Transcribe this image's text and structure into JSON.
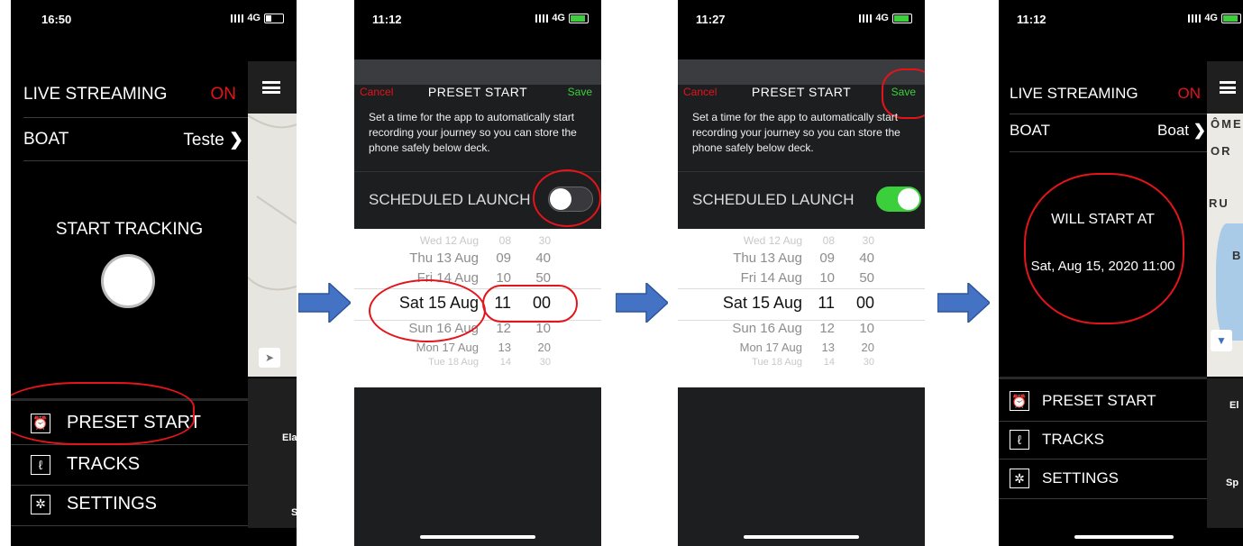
{
  "screen1": {
    "time": "16:50",
    "network": "4G",
    "live_streaming_label": "LIVE STREAMING",
    "live_streaming_value": "ON",
    "boat_label": "BOAT",
    "boat_value": "Teste",
    "start_tracking_label": "START TRACKING",
    "menu": [
      {
        "label": "PRESET START",
        "icon": "alarm-clock-icon"
      },
      {
        "label": "TRACKS",
        "icon": "track-path-icon"
      },
      {
        "label": "SETTINGS",
        "icon": "gear-icon"
      }
    ],
    "peek_texts": [
      "Ela",
      "S"
    ]
  },
  "screen2": {
    "time": "11:12",
    "network": "4G",
    "cancel_label": "Cancel",
    "title": "PRESET START",
    "save_label": "Save",
    "description": "Set a time for the app to automatically start recording your journey so you can store the phone safely below deck.",
    "scheduled_launch_label": "SCHEDULED LAUNCH",
    "toggle_on": false,
    "picker_rows": [
      {
        "date": "Wed 12 Aug",
        "hour": "08",
        "minute": "30"
      },
      {
        "date": "Thu 13 Aug",
        "hour": "09",
        "minute": "40"
      },
      {
        "date": "Fri 14 Aug",
        "hour": "10",
        "minute": "50"
      },
      {
        "date": "Sat 15 Aug",
        "hour": "11",
        "minute": "00"
      },
      {
        "date": "Sun 16 Aug",
        "hour": "12",
        "minute": "10"
      },
      {
        "date": "Mon 17 Aug",
        "hour": "13",
        "minute": "20"
      },
      {
        "date": "Tue 18 Aug",
        "hour": "14",
        "minute": "30"
      }
    ]
  },
  "screen3": {
    "time": "11:27",
    "network": "4G",
    "cancel_label": "Cancel",
    "title": "PRESET START",
    "save_label": "Save",
    "description": "Set a time for the app to automatically start recording your journey so you can store the phone safely below deck.",
    "scheduled_launch_label": "SCHEDULED LAUNCH",
    "toggle_on": true,
    "picker_rows": [
      {
        "date": "Wed 12 Aug",
        "hour": "08",
        "minute": "30"
      },
      {
        "date": "Thu 13 Aug",
        "hour": "09",
        "minute": "40"
      },
      {
        "date": "Fri 14 Aug",
        "hour": "10",
        "minute": "50"
      },
      {
        "date": "Sat 15 Aug",
        "hour": "11",
        "minute": "00"
      },
      {
        "date": "Sun 16 Aug",
        "hour": "12",
        "minute": "10"
      },
      {
        "date": "Mon 17 Aug",
        "hour": "13",
        "minute": "20"
      },
      {
        "date": "Tue 18 Aug",
        "hour": "14",
        "minute": "30"
      }
    ]
  },
  "screen4": {
    "time": "11:12",
    "network": "4G",
    "live_streaming_label": "LIVE STREAMING",
    "live_streaming_value": "ON",
    "boat_label": "BOAT",
    "boat_value": "Boat",
    "will_start_label": "WILL START AT",
    "will_start_value": "Sat, Aug 15, 2020 11:00",
    "menu": [
      {
        "label": "PRESET START",
        "icon": "alarm-clock-icon"
      },
      {
        "label": "TRACKS",
        "icon": "track-path-icon"
      },
      {
        "label": "SETTINGS",
        "icon": "gear-icon"
      }
    ],
    "map_labels": [
      "ÔME",
      "OR",
      "RU",
      "B"
    ],
    "peek_texts": [
      "El",
      "Sp"
    ]
  },
  "colors": {
    "accent_red": "#e4141b",
    "save_green": "#3ccf3c",
    "arrow_blue": "#4472c4",
    "background": "#000000"
  }
}
